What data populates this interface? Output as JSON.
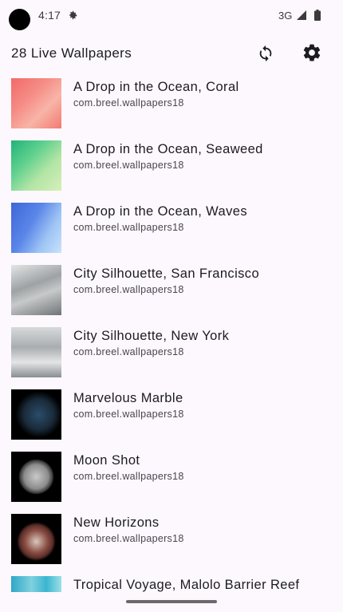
{
  "status_bar": {
    "time": "4:17",
    "network": "3G",
    "icons": [
      "settings-gear-icon",
      "signal-icon",
      "battery-icon"
    ]
  },
  "app_bar": {
    "title": "28 Live Wallpapers",
    "refresh_icon": "refresh-icon",
    "settings_icon": "settings-icon"
  },
  "wallpapers": [
    {
      "title": "A Drop in the Ocean, Coral",
      "package": "com.breel.wallpapers18"
    },
    {
      "title": "A Drop in the Ocean, Seaweed",
      "package": "com.breel.wallpapers18"
    },
    {
      "title": "A Drop in the Ocean, Waves",
      "package": "com.breel.wallpapers18"
    },
    {
      "title": "City Silhouette, San Francisco",
      "package": "com.breel.wallpapers18"
    },
    {
      "title": "City Silhouette, New York",
      "package": "com.breel.wallpapers18"
    },
    {
      "title": "Marvelous Marble",
      "package": "com.breel.wallpapers18"
    },
    {
      "title": "Moon Shot",
      "package": "com.breel.wallpapers18"
    },
    {
      "title": "New Horizons",
      "package": "com.breel.wallpapers18"
    },
    {
      "title": "Tropical Voyage, Malolo Barrier Reef",
      "package": ""
    }
  ],
  "colors": {
    "background": "#fdf8fd",
    "text_primary": "#1c1b1f",
    "text_secondary": "#49454f"
  }
}
